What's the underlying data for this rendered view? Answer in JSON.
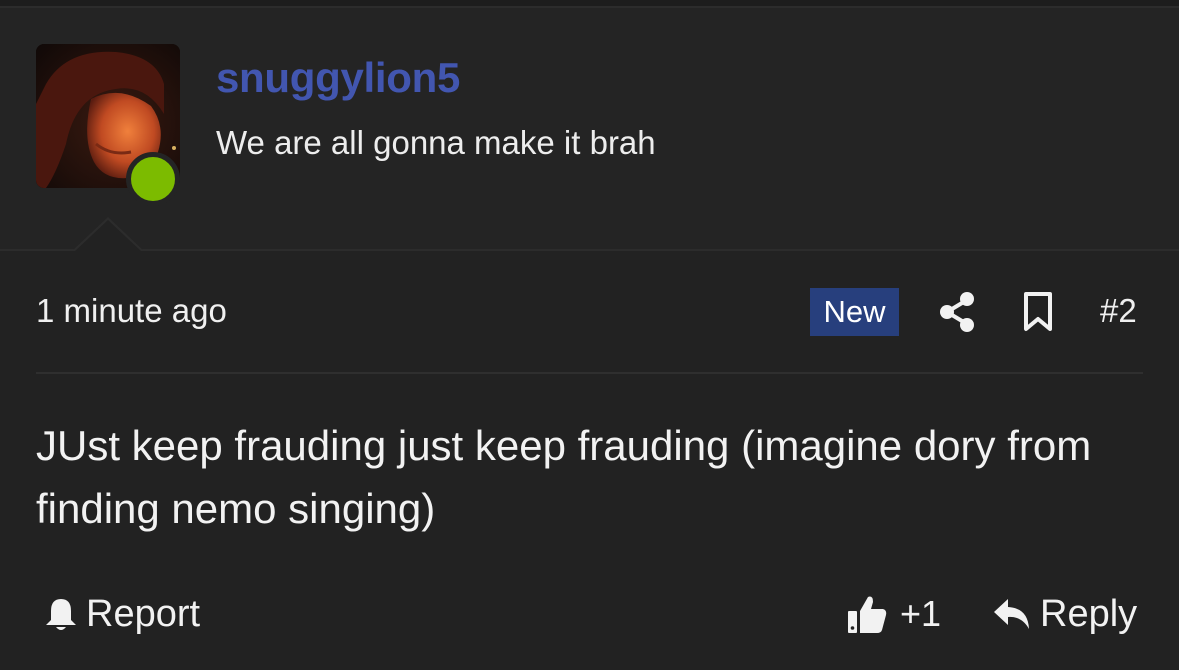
{
  "author": {
    "username": "snuggylion5",
    "title": "We are all gonna make it brah",
    "status": "online",
    "status_color": "#7cbb00",
    "username_color": "#4256b0"
  },
  "post_meta": {
    "time": "1 minute ago",
    "badge": "New",
    "badge_color": "#273f7d",
    "share_icon": "share-icon",
    "bookmark_icon": "bookmark-icon",
    "post_number": "#2"
  },
  "post": {
    "body": "JUst keep frauding just keep frauding (imagine dory from finding nemo singing)"
  },
  "actions": {
    "report_label": "Report",
    "report_icon": "bell-icon",
    "like_icon": "thumbs-up-icon",
    "like_count": "+1",
    "reply_icon": "reply-arrow-icon",
    "reply_label": "Reply"
  }
}
